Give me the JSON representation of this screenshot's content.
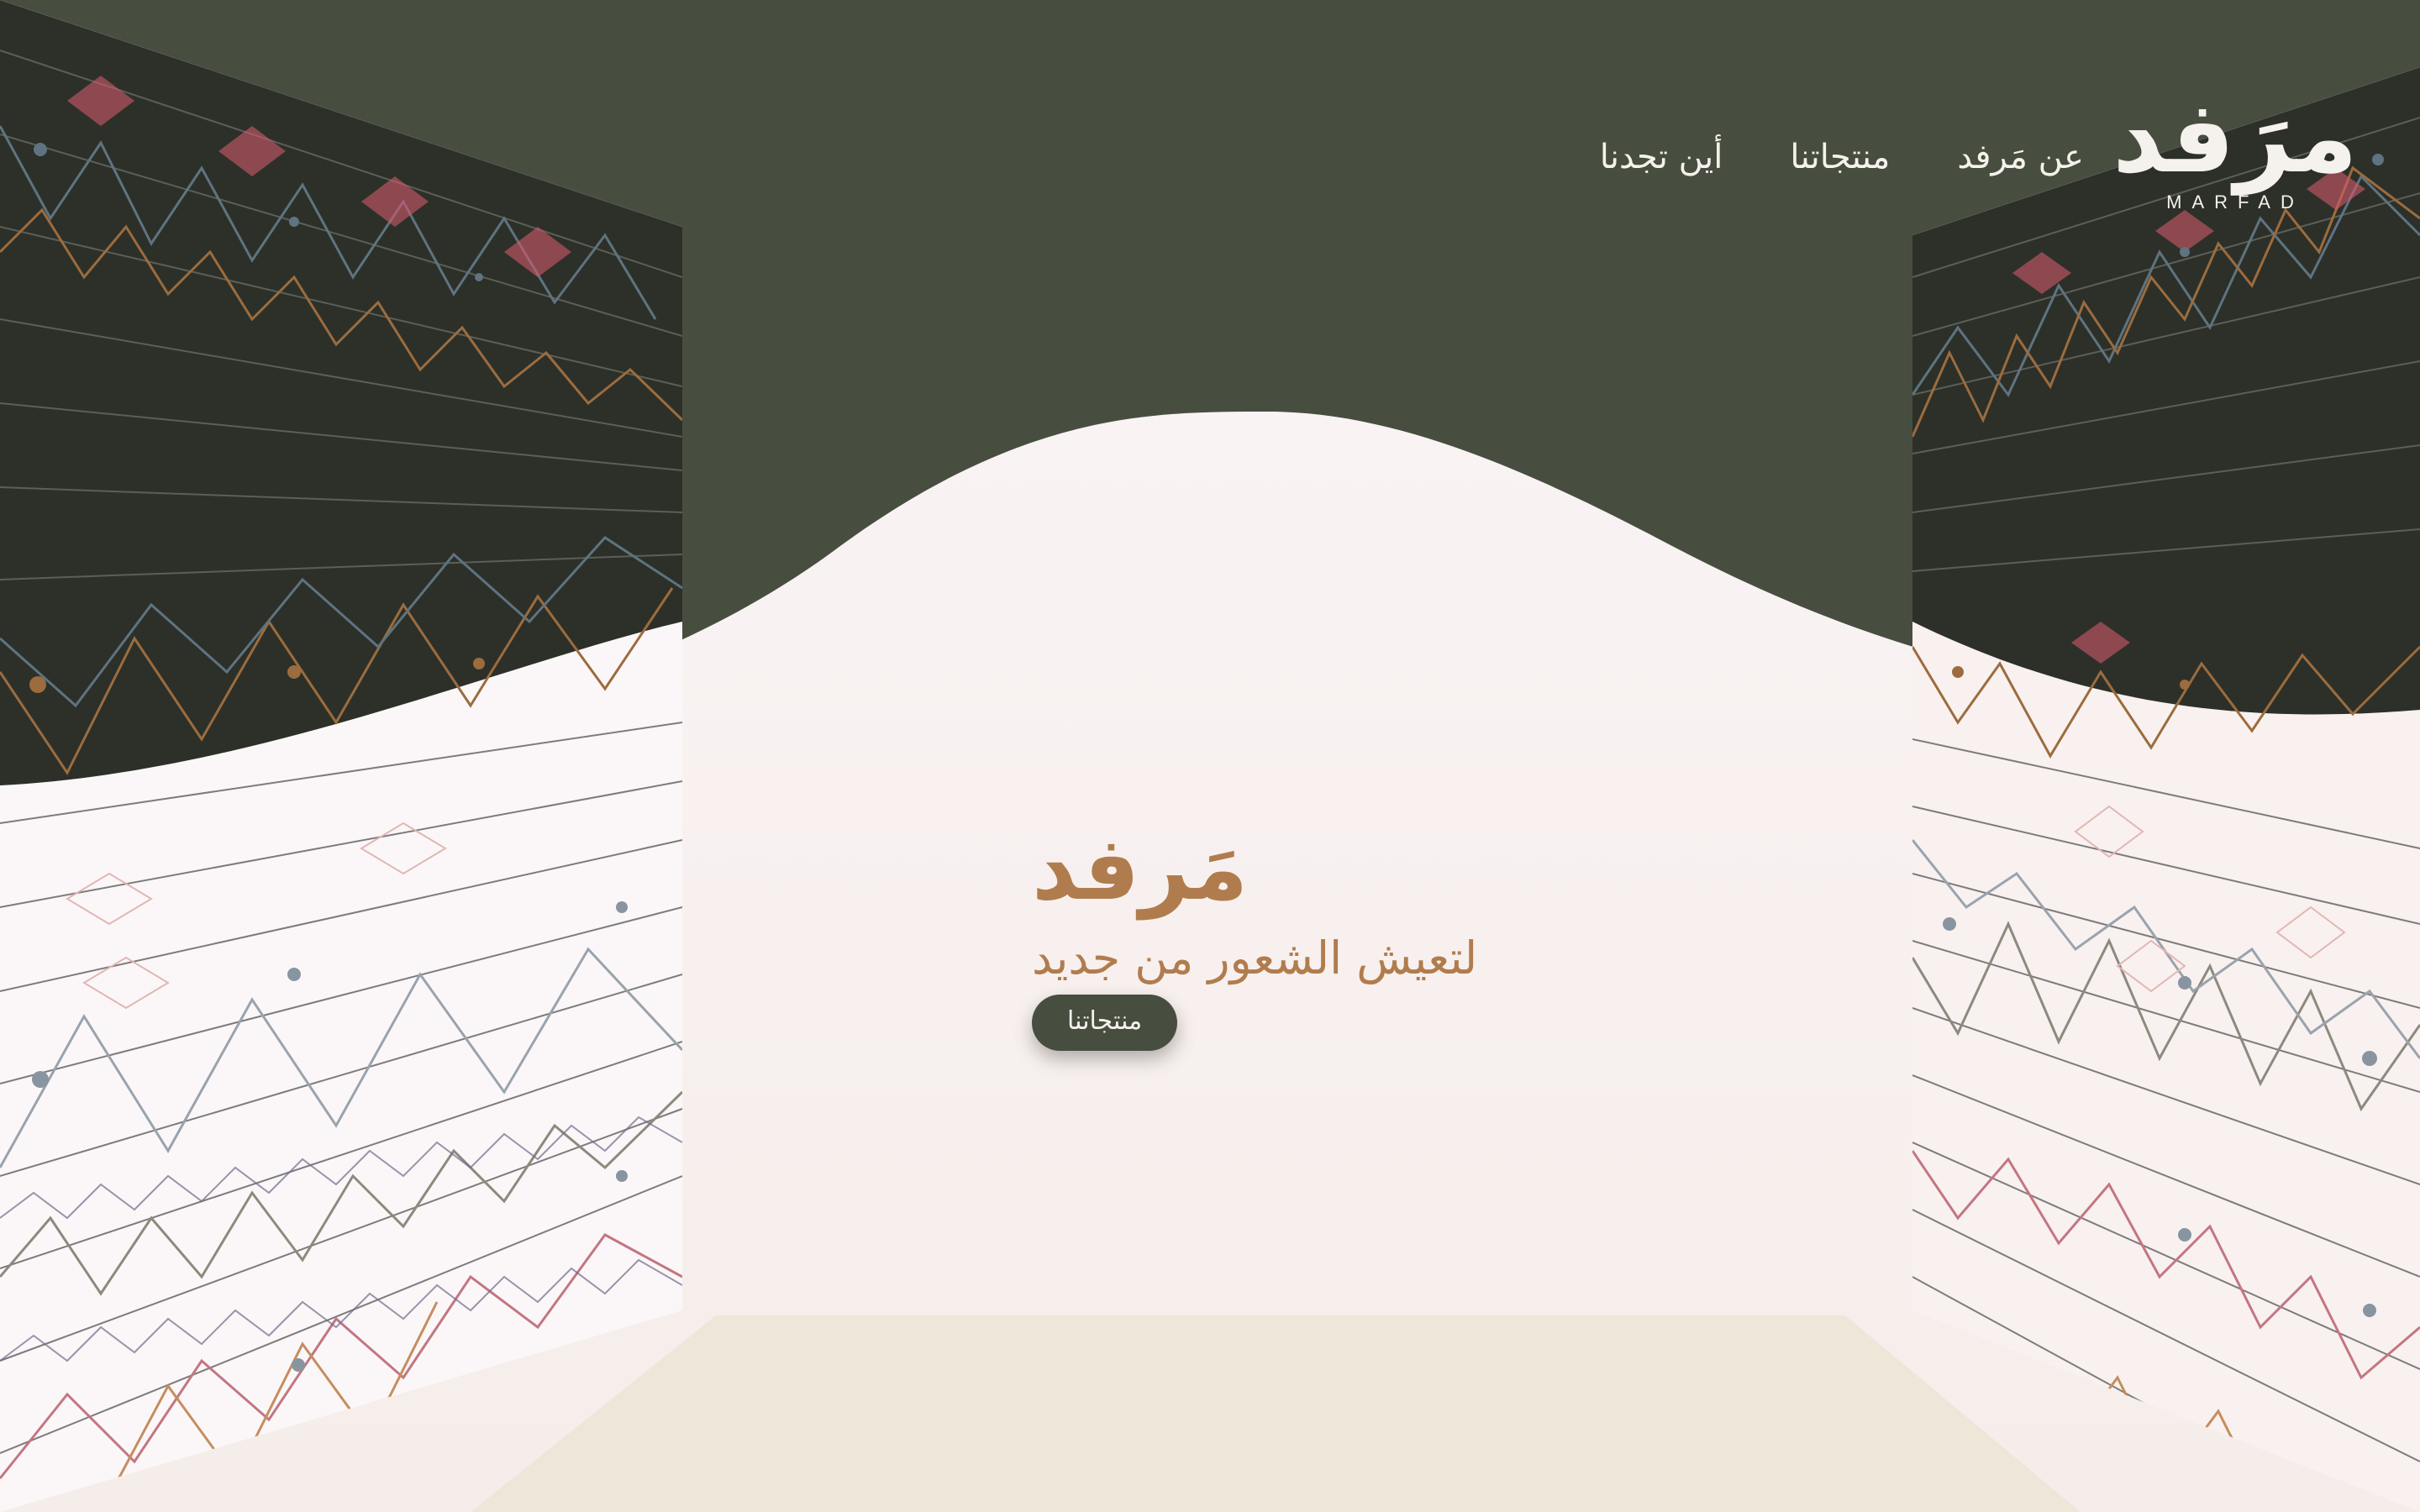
{
  "brand": {
    "logo_ar": "مرَفد",
    "logo_en": "MARFAD"
  },
  "nav": {
    "items": [
      {
        "label": "عن مَرفد"
      },
      {
        "label": "منتجاتنا"
      },
      {
        "label": "أين تجدنا"
      }
    ]
  },
  "hero": {
    "title": "مَرفد",
    "subtitle": "لتعيش الشعور من جديد",
    "cta_label": "منتجاتنا"
  },
  "colors": {
    "primary": "#474e40",
    "accent": "#b17c4d",
    "background": "#f7f0ee",
    "floor": "#efe6da"
  }
}
